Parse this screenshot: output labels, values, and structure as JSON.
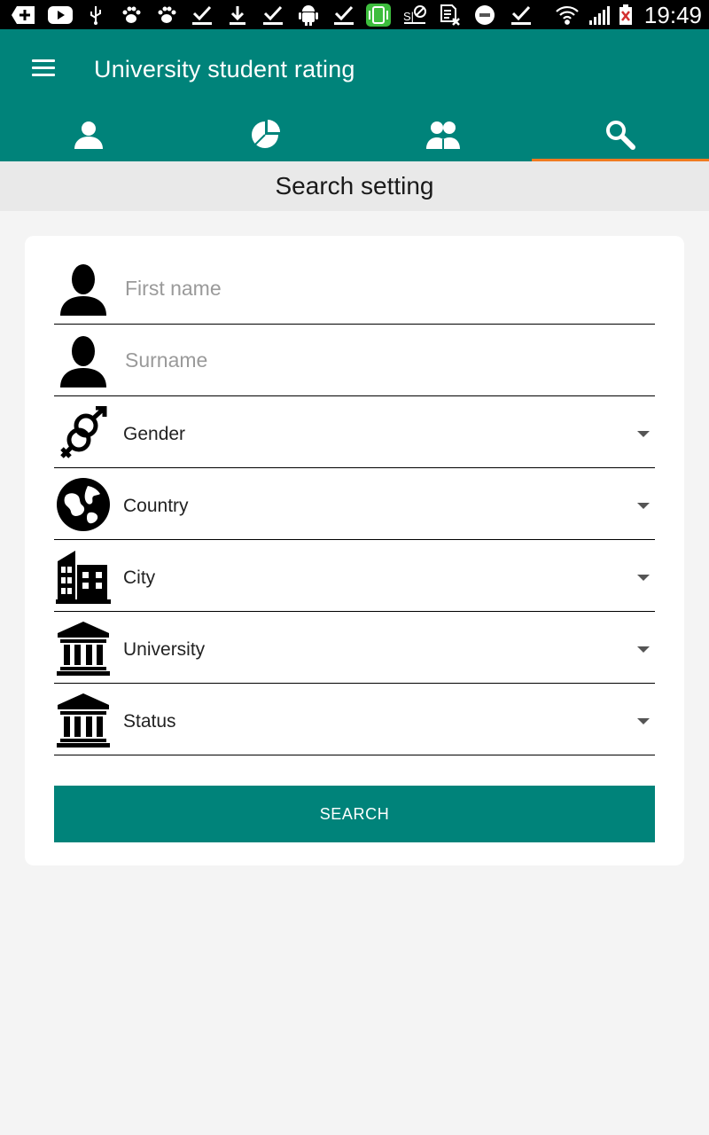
{
  "status_bar": {
    "time": "19:49",
    "icons": [
      "plus-box-icon",
      "youtube-icon",
      "usb-icon",
      "paw-icon",
      "paw-icon",
      "check-icon",
      "download-icon",
      "check-icon",
      "android-icon",
      "check-icon",
      "screen-rotate-icon",
      "nfc-icon",
      "sim-x-icon",
      "galaxy-icon",
      "check-icon",
      "wifi-icon",
      "signal-icon",
      "battery-icon"
    ]
  },
  "app_bar": {
    "title": "University student rating",
    "menu_icon": "hamburger-menu-icon",
    "background": "#00837a",
    "tabs": [
      {
        "icon": "person-icon",
        "active": false
      },
      {
        "icon": "pie-chart-icon",
        "active": false
      },
      {
        "icon": "people-icon",
        "active": false
      },
      {
        "icon": "search-icon",
        "active": true
      }
    ],
    "active_indicator_color": "#f07a20"
  },
  "section_header": {
    "title": "Search setting"
  },
  "form": {
    "first_name": {
      "placeholder": "First name",
      "value": "",
      "icon": "person-silhouette-icon"
    },
    "surname": {
      "placeholder": "Surname",
      "value": "",
      "icon": "person-silhouette-icon"
    },
    "gender": {
      "label": "Gender",
      "icon": "gender-symbol-icon"
    },
    "country": {
      "label": "Country",
      "icon": "globe-icon"
    },
    "city": {
      "label": "City",
      "icon": "buildings-icon"
    },
    "university": {
      "label": "University",
      "icon": "institution-icon"
    },
    "status": {
      "label": "Status",
      "icon": "institution-icon"
    },
    "search_label": "SEARCH"
  }
}
